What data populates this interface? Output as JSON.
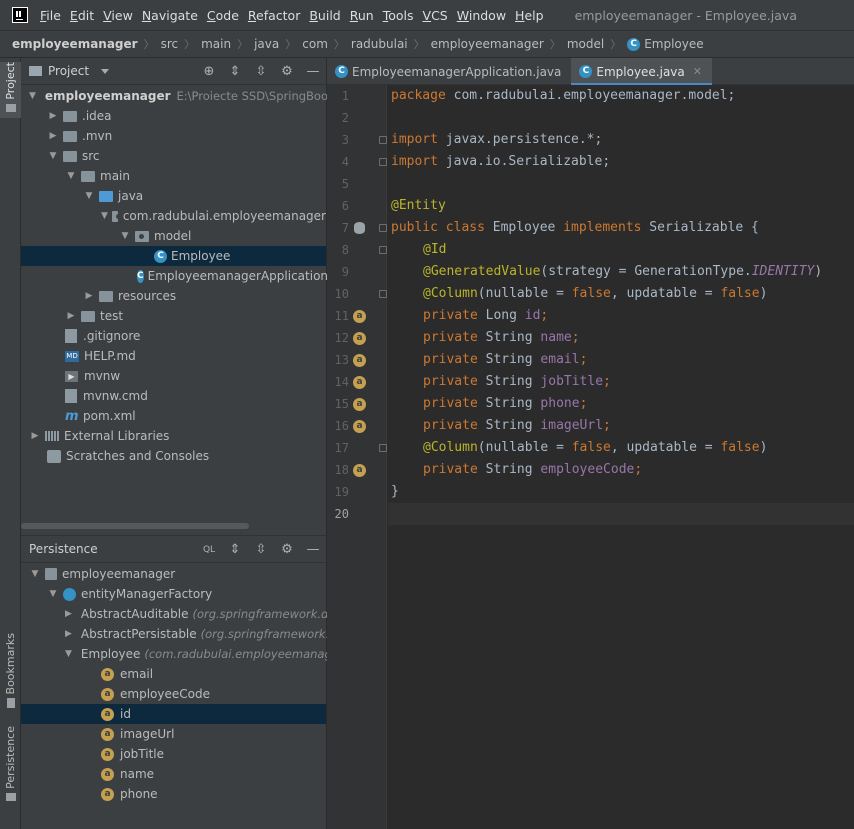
{
  "menu": [
    "File",
    "Edit",
    "View",
    "Navigate",
    "Code",
    "Refactor",
    "Build",
    "Run",
    "Tools",
    "VCS",
    "Window",
    "Help"
  ],
  "window_title": "employeemanager - Employee.java",
  "breadcrumb": [
    "employeemanager",
    "src",
    "main",
    "java",
    "com",
    "radubulai",
    "employeemanager",
    "model",
    "Employee"
  ],
  "left_strip": {
    "project": "Project",
    "bookmarks": "Bookmarks",
    "persistence": "Persistence"
  },
  "project_panel": {
    "title": "Project",
    "tree": [
      {
        "label": "employeemanager",
        "hint": "E:\\Proiecte SSD\\SpringBoot\\e"
      },
      {
        "label": ".idea"
      },
      {
        "label": ".mvn"
      },
      {
        "label": "src"
      },
      {
        "label": "main"
      },
      {
        "label": "java"
      },
      {
        "label": "com.radubulai.employeemanager"
      },
      {
        "label": "model"
      },
      {
        "label": "Employee"
      },
      {
        "label": "EmployeemanagerApplication"
      },
      {
        "label": "resources"
      },
      {
        "label": "test"
      },
      {
        "label": ".gitignore"
      },
      {
        "label": "HELP.md"
      },
      {
        "label": "mvnw"
      },
      {
        "label": "mvnw.cmd"
      },
      {
        "label": "pom.xml"
      },
      {
        "label": "External Libraries"
      },
      {
        "label": "Scratches and Consoles"
      }
    ]
  },
  "persistence_panel": {
    "title": "Persistence",
    "tree": [
      {
        "label": "employeemanager"
      },
      {
        "label": "entityManagerFactory"
      },
      {
        "label": "AbstractAuditable",
        "hint": "(org.springframework.da"
      },
      {
        "label": "AbstractPersistable",
        "hint": "(org.springframework.d"
      },
      {
        "label": "Employee",
        "hint": "(com.radubulai.employeemanag"
      },
      {
        "label": "email"
      },
      {
        "label": "employeeCode"
      },
      {
        "label": "id"
      },
      {
        "label": "imageUrl"
      },
      {
        "label": "jobTitle"
      },
      {
        "label": "name"
      },
      {
        "label": "phone"
      }
    ]
  },
  "editor": {
    "tabs": [
      {
        "label": "EmployeemanagerApplication.java"
      },
      {
        "label": "Employee.java"
      }
    ],
    "code": {
      "l1_kw": "package",
      "l1_rest": " com.radubulai.employeemanager.model;",
      "l3_kw": "import",
      "l3_rest": " javax.persistence.*;",
      "l4_kw": "import",
      "l4_rest": " java.io.Serializable;",
      "l6_an": "@Entity",
      "l7_kw1": "public class",
      "l7_name": " Employee ",
      "l7_kw2": "implements",
      "l7_rest": " Serializable {",
      "l8_an": "@Id",
      "l9_an": "@GeneratedValue",
      "l9_rest": "(strategy = GenerationType.",
      "l9_it": "IDENTITY",
      "l9_end": ")",
      "l10_an": "@Column",
      "l10_a": "(nullable = ",
      "l10_f1": "false",
      "l10_b": ", updatable = ",
      "l10_f2": "false",
      "l10_c": ")",
      "l11_kw": "private",
      "l11_type": " Long ",
      "l11_fld": "id",
      "l11_end": ";",
      "l12_kw": "private",
      "l12_type": " String ",
      "l12_fld": "name",
      "l12_end": ";",
      "l13_kw": "private",
      "l13_type": " String ",
      "l13_fld": "email",
      "l13_end": ";",
      "l14_kw": "private",
      "l14_type": " String ",
      "l14_fld": "jobTitle",
      "l14_end": ";",
      "l15_kw": "private",
      "l15_type": " String ",
      "l15_fld": "phone",
      "l15_end": ";",
      "l16_kw": "private",
      "l16_type": " String ",
      "l16_fld": "imageUrl",
      "l16_end": ";",
      "l17_an": "@Column",
      "l17_a": "(nullable = ",
      "l17_f1": "false",
      "l17_b": ", updatable = ",
      "l17_f2": "false",
      "l17_c": ")",
      "l18_kw": "private",
      "l18_type": " String ",
      "l18_fld": "employeeCode",
      "l18_end": ";",
      "l19": "}"
    },
    "line_numbers": [
      "1",
      "2",
      "3",
      "4",
      "5",
      "6",
      "7",
      "8",
      "9",
      "10",
      "11",
      "12",
      "13",
      "14",
      "15",
      "16",
      "17",
      "18",
      "19",
      "20"
    ]
  },
  "icons": {
    "class": "C",
    "attr": "a"
  }
}
